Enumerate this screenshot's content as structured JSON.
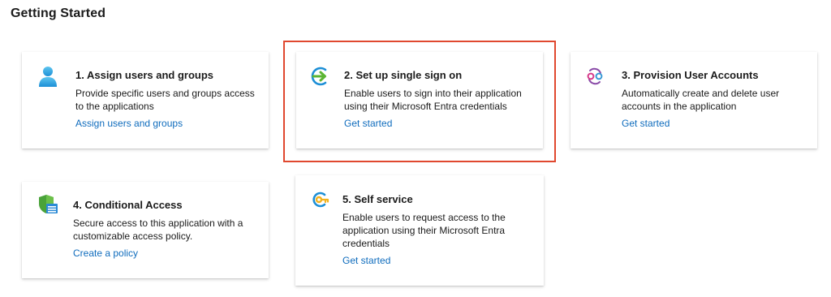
{
  "page": {
    "title": "Getting Started"
  },
  "cards": [
    {
      "title": "1. Assign users and groups",
      "description": "Provide specific users and groups access to the applications",
      "link": "Assign users and groups",
      "icon": "user-icon"
    },
    {
      "title": "2. Set up single sign on",
      "description": "Enable users to sign into their application using their Microsoft Entra credentials",
      "link": "Get started",
      "icon": "sign-in-arrow-icon",
      "highlighted": true
    },
    {
      "title": "3. Provision User Accounts",
      "description": "Automatically create and delete user accounts in the application",
      "link": "Get started",
      "icon": "provisioning-cycle-icon"
    },
    {
      "title": "4. Conditional Access",
      "description": "Secure access to this application with a customizable access policy.",
      "link": "Create a policy",
      "icon": "shield-policy-icon"
    },
    {
      "title": "5. Self service",
      "description": "Enable users to request access to the application using their Microsoft Entra credentials",
      "link": "Get started",
      "icon": "self-service-key-icon"
    }
  ],
  "colors": {
    "link": "#0f6cbd",
    "highlight_border": "#e0482f"
  }
}
